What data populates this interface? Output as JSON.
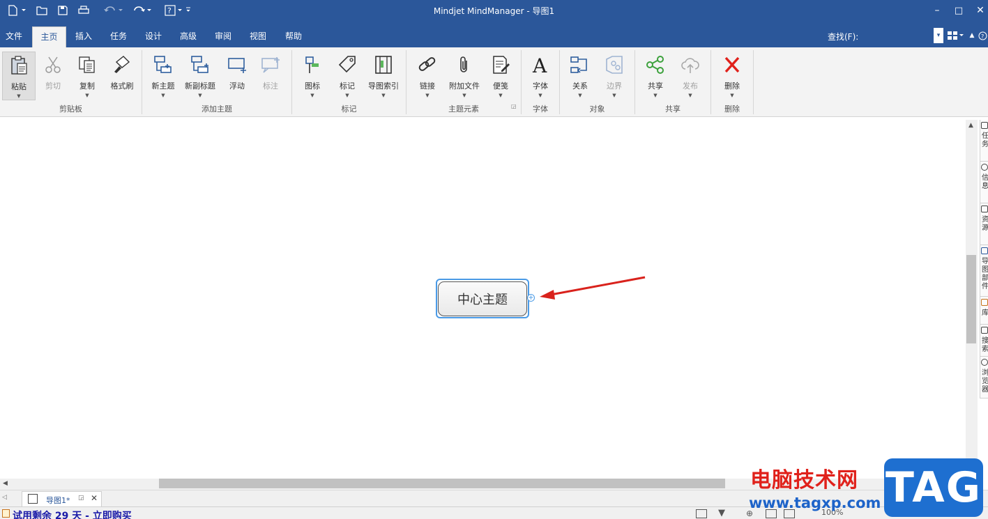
{
  "window": {
    "title": "Mindjet MindManager - 导图1",
    "minimize": "–",
    "maximize": "□",
    "close": "✕"
  },
  "tabs": [
    {
      "label": "文件"
    },
    {
      "label": "主页"
    },
    {
      "label": "插入"
    },
    {
      "label": "任务"
    },
    {
      "label": "设计"
    },
    {
      "label": "高级"
    },
    {
      "label": "审阅"
    },
    {
      "label": "视图"
    },
    {
      "label": "帮助"
    }
  ],
  "find": {
    "label": "查找(F):",
    "value": ""
  },
  "ribbon": {
    "buttons": [
      {
        "label": "粘贴",
        "icon": "paste-icon",
        "enabled": true
      },
      {
        "label": "剪切",
        "icon": "scissors-icon",
        "enabled": false
      },
      {
        "label": "复制",
        "icon": "copy-icon",
        "enabled": true
      },
      {
        "label": "格式刷",
        "icon": "format-painter-icon",
        "enabled": true
      },
      {
        "label": "新主题",
        "icon": "new-topic-icon",
        "enabled": true
      },
      {
        "label": "新副标题",
        "icon": "new-subtopic-icon",
        "enabled": true
      },
      {
        "label": "浮动",
        "icon": "floating-topic-icon",
        "enabled": true
      },
      {
        "label": "标注",
        "icon": "callout-icon",
        "enabled": false
      },
      {
        "label": "图标",
        "icon": "marker-icon",
        "enabled": true
      },
      {
        "label": "标记",
        "icon": "tag-icon",
        "enabled": true
      },
      {
        "label": "导图索引",
        "icon": "map-index-icon",
        "enabled": true
      },
      {
        "label": "链接",
        "icon": "link-icon",
        "enabled": true
      },
      {
        "label": "附加文件",
        "icon": "paperclip-icon",
        "enabled": true
      },
      {
        "label": "便笺",
        "icon": "notes-icon",
        "enabled": true
      },
      {
        "label": "字体",
        "icon": "font-icon",
        "enabled": true
      },
      {
        "label": "关系",
        "icon": "relationship-icon",
        "enabled": true
      },
      {
        "label": "边界",
        "icon": "boundary-icon",
        "enabled": false
      },
      {
        "label": "共享",
        "icon": "share-icon",
        "enabled": true
      },
      {
        "label": "发布",
        "icon": "publish-cloud-icon",
        "enabled": false
      },
      {
        "label": "删除",
        "icon": "delete-x-icon",
        "enabled": true
      }
    ],
    "groups": [
      {
        "label": "剪贴板"
      },
      {
        "label": "添加主题"
      },
      {
        "label": "标记"
      },
      {
        "label": "主题元素"
      },
      {
        "label": "字体"
      },
      {
        "label": "对象"
      },
      {
        "label": "共享"
      },
      {
        "label": "删除"
      }
    ]
  },
  "map": {
    "central_topic": "中心主题",
    "expand_symbol": "+"
  },
  "side_panel": [
    {
      "label": "任务"
    },
    {
      "label": "信息"
    },
    {
      "label": "资源"
    },
    {
      "label": "导图部件"
    },
    {
      "label": "库"
    },
    {
      "label": "搜索"
    },
    {
      "label": "浏览器"
    }
  ],
  "doc_tab": {
    "label": "导图1*"
  },
  "status": {
    "trial_text": "试用剩余 29 天 - 立即购买",
    "zoom": "100%"
  },
  "watermark": {
    "title": "电脑技术网",
    "url": "www.tagxp.com",
    "logo": "TAG"
  },
  "colors": {
    "titlebar": "#2b579a",
    "accent": "#4a9ae6",
    "arrow": "#d9221c",
    "delete": "#e0211b"
  }
}
